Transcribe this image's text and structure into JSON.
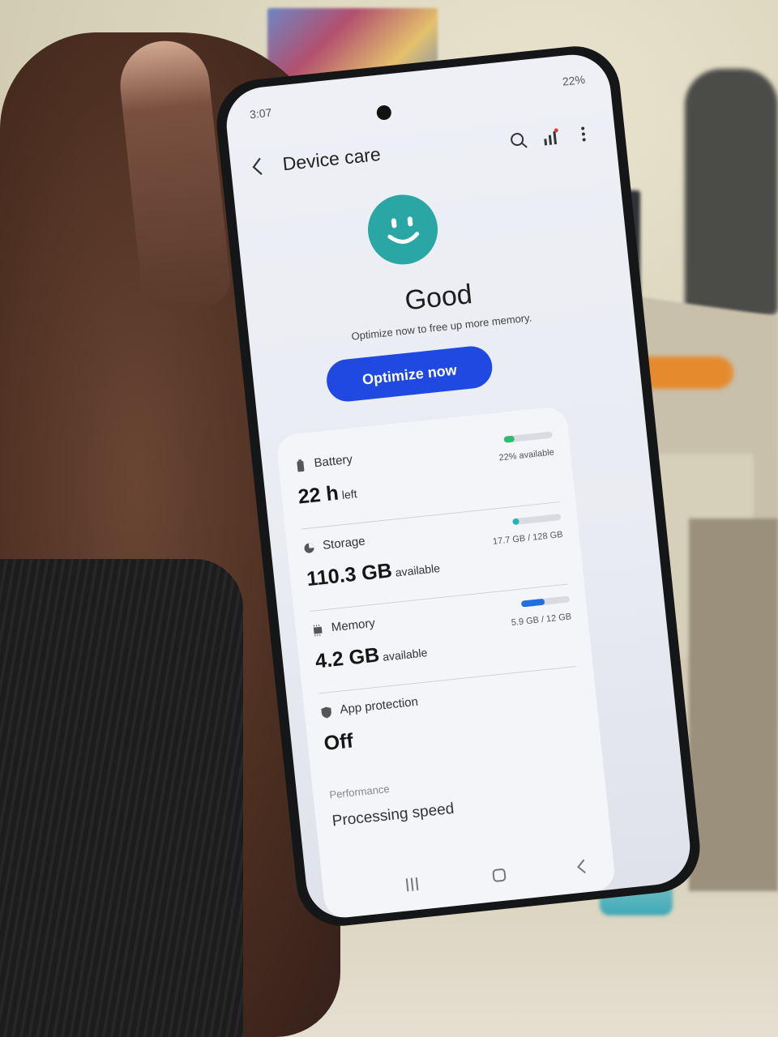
{
  "status_bar": {
    "time": "3:07",
    "battery": "22%"
  },
  "header": {
    "title": "Device care"
  },
  "summary": {
    "status": "Good",
    "message": "Optimize now to free up more memory.",
    "button_label": "Optimize now"
  },
  "items": [
    {
      "label": "Battery",
      "value": "22 h",
      "unit": "left",
      "meta": "22% available",
      "fill": 0.22,
      "color": "#2dbe6c"
    },
    {
      "label": "Storage",
      "value": "110.3 GB",
      "unit": "available",
      "meta": "17.7 GB / 128 GB",
      "fill": 0.14,
      "color": "#27b3b5"
    },
    {
      "label": "Memory",
      "value": "4.2 GB",
      "unit": "available",
      "meta": "5.9 GB / 12 GB",
      "fill": 0.49,
      "color": "#1f6fe0"
    },
    {
      "label": "App protection",
      "value": "Off"
    }
  ],
  "performance": {
    "heading": "Performance",
    "item": "Processing speed"
  },
  "icons": {
    "back": "chevron-left-icon",
    "search": "search-icon",
    "stats": "bar-chart-icon",
    "more": "more-vert-icon",
    "face": "smiley-face-icon"
  },
  "colors": {
    "accent": "#1f49e0",
    "face": "#2aa7a5"
  }
}
